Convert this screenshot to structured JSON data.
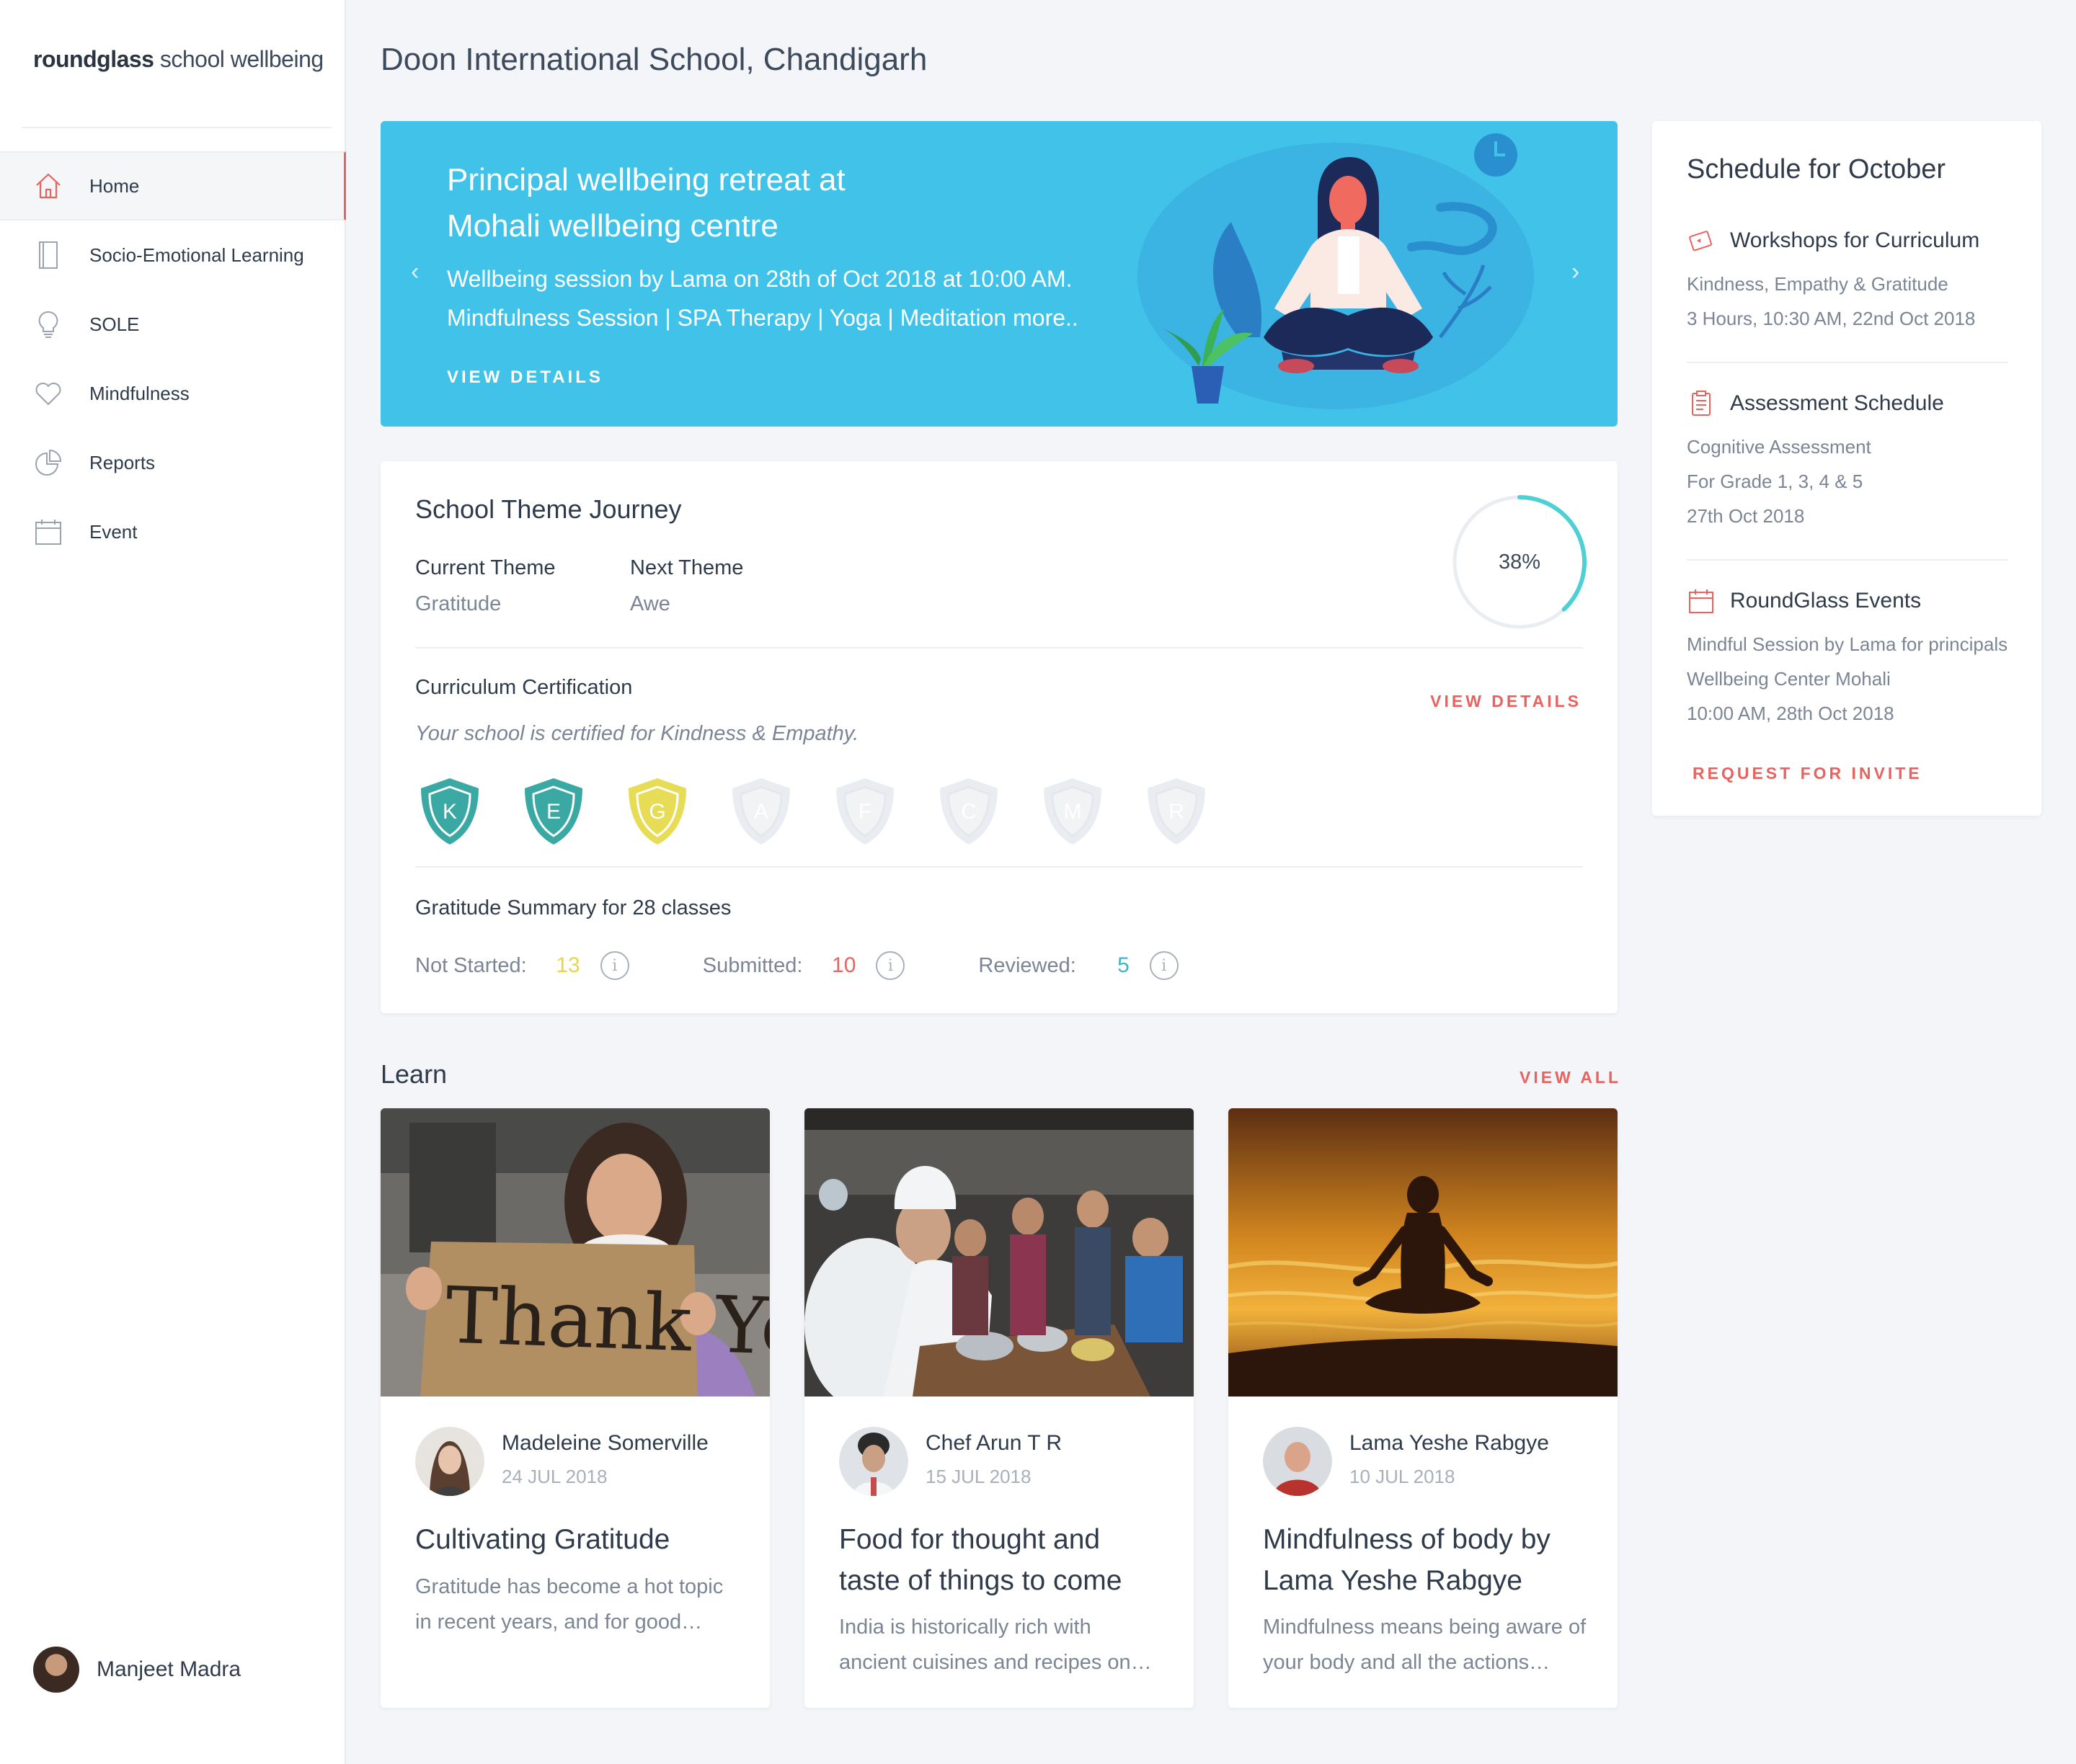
{
  "brand": {
    "logo_bold": "roundglass",
    "logo_rest": " school wellbeing"
  },
  "nav": {
    "items": [
      {
        "label": "Home",
        "icon": "home-icon"
      },
      {
        "label": "Socio-Emotional Learning",
        "icon": "book-icon"
      },
      {
        "label": "SOLE",
        "icon": "bulb-icon"
      },
      {
        "label": "Mindfulness",
        "icon": "heart-icon"
      },
      {
        "label": "Reports",
        "icon": "pie-chart-icon"
      },
      {
        "label": "Event",
        "icon": "calendar-icon"
      }
    ],
    "active": "Home"
  },
  "user": {
    "name": "Manjeet Madra"
  },
  "page": {
    "title": "Doon International School, Chandigarh"
  },
  "hero": {
    "title_line1": "Principal wellbeing retreat at",
    "title_line2": "Mohali wellbeing centre",
    "sub_line1": "Wellbeing session by Lama on 28th of Oct 2018 at 10:00 AM.",
    "sub_line2": "Mindfulness Session | SPA Therapy | Yoga | Meditation more..",
    "link": "VIEW DETAILS",
    "prev_arrow": "‹",
    "next_arrow": "›"
  },
  "theme": {
    "title": "School Theme Journey",
    "current_label": "Current Theme",
    "current_value": "Gratitude",
    "next_label": "Next Theme",
    "next_value": "Awe",
    "progress": 38,
    "progress_text": "38%",
    "cert_title": "Curriculum Certification",
    "cert_link": "VIEW DETAILS",
    "cert_desc": "Your school is certified for Kindness & Empathy.",
    "badges": [
      {
        "letter": "K",
        "state": "earned",
        "color": "#3aa9a3"
      },
      {
        "letter": "E",
        "state": "earned",
        "color": "#3aa9a3"
      },
      {
        "letter": "G",
        "state": "current",
        "color": "#e7dc55"
      },
      {
        "letter": "A",
        "state": "locked",
        "color": "#e9edf1"
      },
      {
        "letter": "F",
        "state": "locked",
        "color": "#e9edf1"
      },
      {
        "letter": "C",
        "state": "locked",
        "color": "#e9edf1"
      },
      {
        "letter": "M",
        "state": "locked",
        "color": "#e9edf1"
      },
      {
        "letter": "R",
        "state": "locked",
        "color": "#e9edf1"
      }
    ],
    "summary_title": "Gratitude Summary for 28 classes",
    "stats": [
      {
        "label": "Not Started:",
        "value": "13",
        "color": "#e6d64c"
      },
      {
        "label": "Submitted:",
        "value": "10",
        "color": "#e8625f"
      },
      {
        "label": "Reviewed:",
        "value": "5",
        "color": "#3fb5cd"
      }
    ],
    "info_glyph": "i"
  },
  "learn": {
    "title": "Learn",
    "link": "VIEW ALL",
    "cards": [
      {
        "author": "Madeleine Somerville",
        "date": "24 JUL 2018",
        "headline": "Cultivating Gratitude",
        "desc": "Gratitude has become a hot topic in recent years, and for good…",
        "sign_text": "Thank You"
      },
      {
        "author": "Chef Arun T R",
        "date": "15 JUL 2018",
        "headline": "Food for thought and taste of things to come",
        "desc": "India is historically rich with ancient cuisines and recipes on…"
      },
      {
        "author": "Lama Yeshe Rabgye",
        "date": "10 JUL 2018",
        "headline": "Mindfulness of body by Lama Yeshe Rabgye",
        "desc": "Mindfulness means being aware of your body and all the actions…"
      }
    ]
  },
  "schedule": {
    "title": "Schedule for October",
    "items": [
      {
        "icon": "ticket-icon",
        "title": "Workshops for Curriculum",
        "lines": [
          "Kindness, Empathy & Gratitude",
          "3 Hours, 10:30 AM, 22nd Oct 2018"
        ]
      },
      {
        "icon": "clipboard-icon",
        "title": "Assessment Schedule",
        "lines": [
          "Cognitive Assessment",
          "For Grade 1, 3, 4 & 5",
          "27th Oct 2018"
        ]
      },
      {
        "icon": "calendar-icon",
        "title": "RoundGlass Events",
        "lines": [
          "Mindful Session by Lama for principals",
          "Wellbeing Center Mohali",
          "10:00 AM, 28th Oct 2018"
        ]
      }
    ],
    "link": "REQUEST FOR INVITE"
  },
  "colors": {
    "accent": "#e8625f",
    "hero_bg": "#41c3e9",
    "teal": "#3aa9a3"
  }
}
